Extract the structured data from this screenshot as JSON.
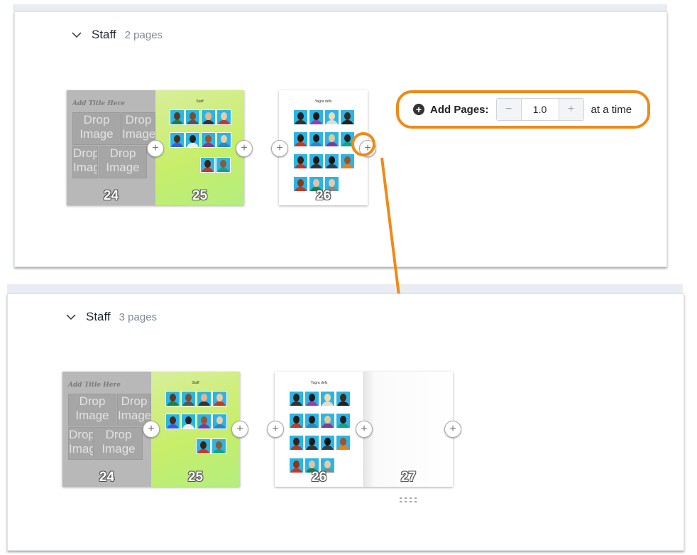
{
  "top_section": {
    "title": "Staff",
    "page_count": "2 pages",
    "pages": [
      {
        "number": "24",
        "kind": "template",
        "handwriting": "Add Title Here",
        "drop_label": "Drop Image"
      },
      {
        "number": "25",
        "kind": "staff-photos",
        "title": "Staff"
      },
      {
        "number": "26",
        "kind": "staff-photos",
        "title": "Yagra defs"
      }
    ]
  },
  "add_pages": {
    "label": "Add Pages:",
    "minus": "−",
    "value": "1.0",
    "plus": "+",
    "suffix": "at a time"
  },
  "bottom_section": {
    "title": "Staff",
    "page_count": "3 pages",
    "pages": [
      {
        "number": "24",
        "kind": "template",
        "handwriting": "Add Title Here",
        "drop_label": "Drop Image"
      },
      {
        "number": "25",
        "kind": "staff-photos",
        "title": "Staff"
      },
      {
        "number": "26",
        "kind": "staff-photos",
        "title": "Yagra defs"
      },
      {
        "number": "27",
        "kind": "blank"
      }
    ]
  },
  "icons": {
    "add_page": "plus-circle-icon",
    "collapse": "chevron-down-icon",
    "add_pages": "plus-circle-filled-icon",
    "drag": "drag-handle-icon"
  },
  "colors": {
    "highlight": "#f08a17",
    "panel_bg": "#ffffff",
    "backdrop": "#e9edf3",
    "photo_bg": "#29b6e6",
    "green_page": "#c8ee6a"
  }
}
